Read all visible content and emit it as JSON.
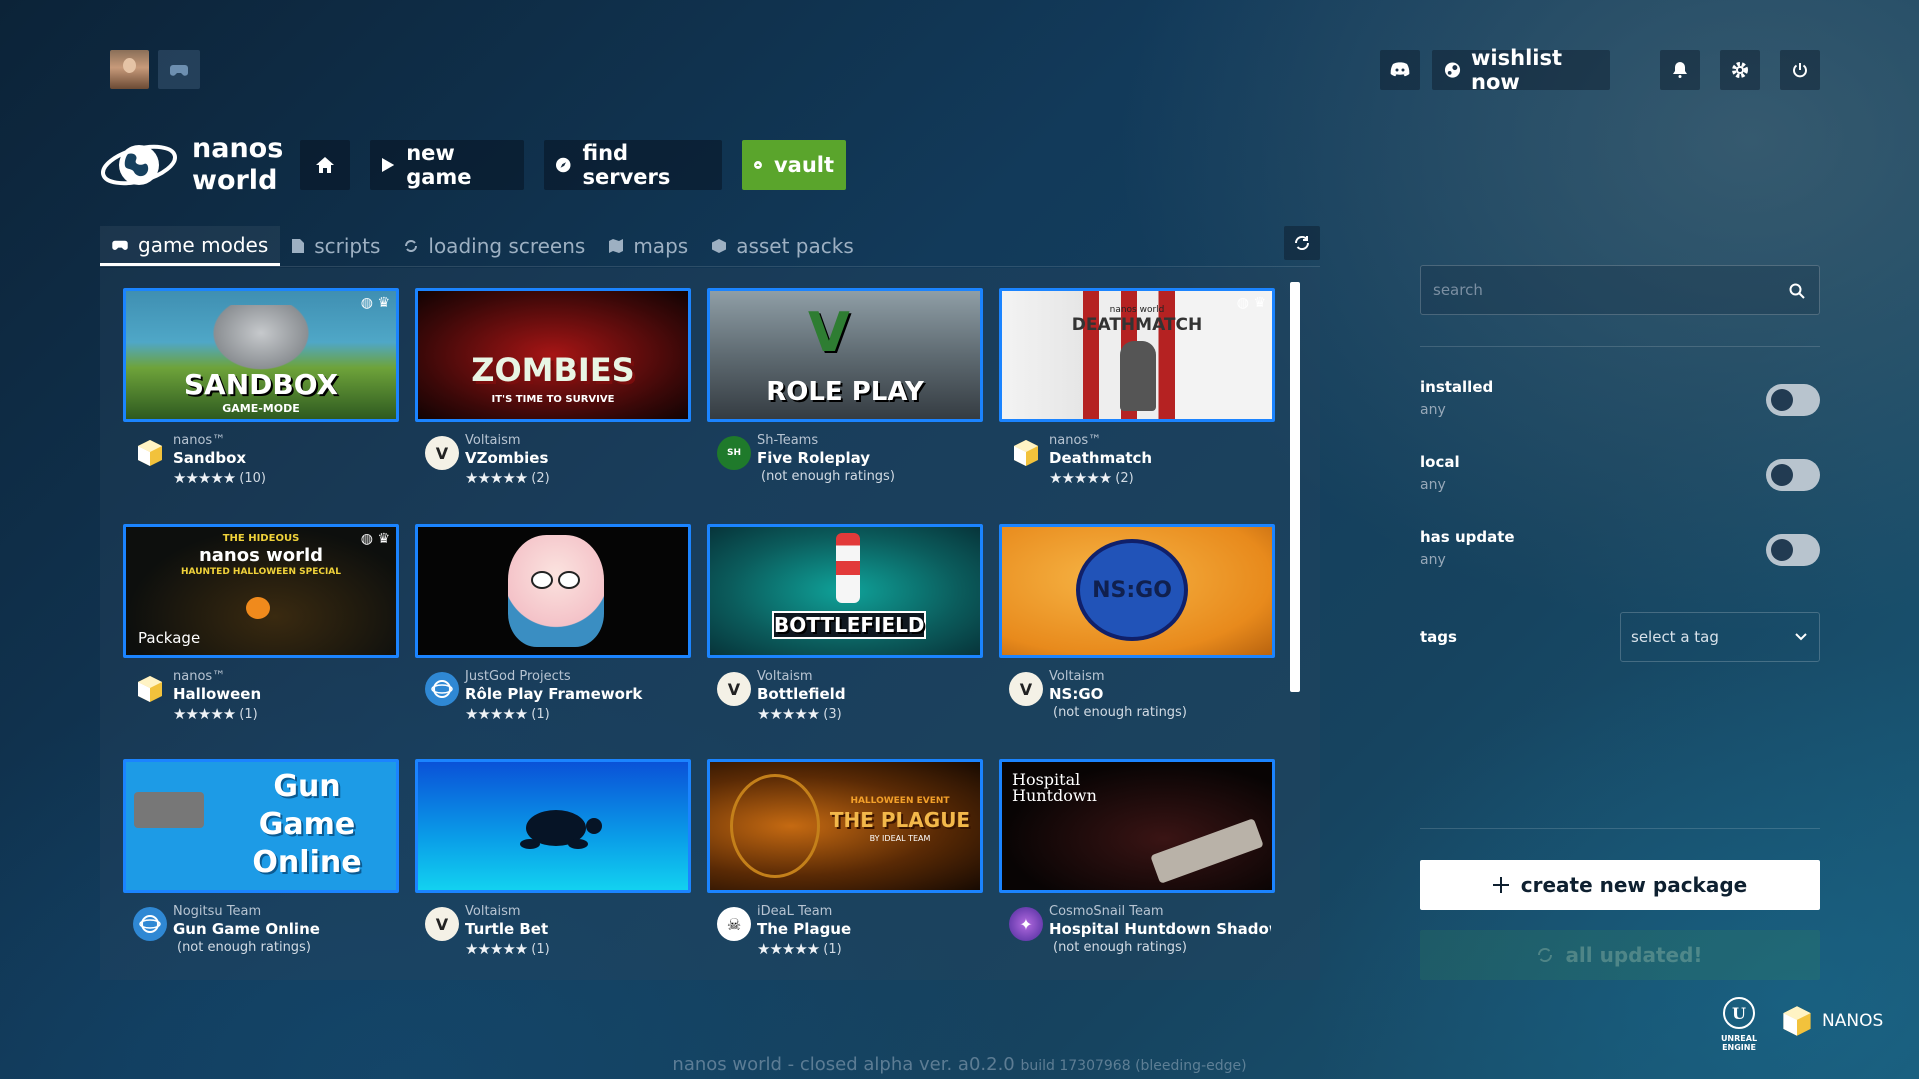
{
  "topbar": {
    "wishlist_label": "wishlist now"
  },
  "logo": {
    "line1": "nanos",
    "line2": "world"
  },
  "nav": {
    "new_game": "new game",
    "find_servers": "find servers",
    "vault": "vault"
  },
  "tabs": [
    {
      "label": "game modes",
      "active": true
    },
    {
      "label": "scripts"
    },
    {
      "label": "loading screens"
    },
    {
      "label": "maps"
    },
    {
      "label": "asset packs"
    }
  ],
  "packages": [
    {
      "author": "nanos™",
      "name": "Sandbox",
      "stars": "★★★★★",
      "count": "(10)",
      "thumb": "SANDBOX"
    },
    {
      "author": "Voltaism",
      "name": "VZombies",
      "stars": "★★★★★",
      "count": "(2)",
      "thumb": "ZOMBIES"
    },
    {
      "author": "Sh-Teams",
      "name": "Five Roleplay",
      "stars": "",
      "count": "(not enough ratings)",
      "thumb": "ROLE PLAY"
    },
    {
      "author": "nanos™",
      "name": "Deathmatch",
      "stars": "★★★★★",
      "count": "(2)",
      "thumb": "DEATHMATCH"
    },
    {
      "author": "nanos™",
      "name": "Halloween",
      "stars": "★★★★★",
      "count": "(1)",
      "thumb": "nanos world"
    },
    {
      "author": "JustGod Projects",
      "name": "Rôle Play Framework",
      "stars": "★★★★★",
      "count": "(1)",
      "thumb": ""
    },
    {
      "author": "Voltaism",
      "name": "Bottlefield",
      "stars": "★★★★★",
      "count": "(3)",
      "thumb": "BOTTLEFIELD"
    },
    {
      "author": "Voltaism",
      "name": "NS:GO",
      "stars": "",
      "count": "(not enough ratings)",
      "thumb": "NS:GO"
    },
    {
      "author": "Nogitsu Team",
      "name": "Gun Game Online",
      "stars": "",
      "count": "(not enough ratings)",
      "thumb": "Gun Game Online"
    },
    {
      "author": "Voltaism",
      "name": "Turtle Bet",
      "stars": "★★★★★",
      "count": "(1)",
      "thumb": ""
    },
    {
      "author": "iDeaL Team",
      "name": "The Plague",
      "stars": "★★★★★",
      "count": "(1)",
      "thumb": "THE PLAGUE"
    },
    {
      "author": "CosmoSnail Team",
      "name": "Hospital Huntdown Shadow:",
      "stars": "",
      "count": "(not enough ratings)",
      "thumb": "Hospital Huntdown"
    }
  ],
  "thumb_extra": {
    "sandbox_sub": "GAME-MODE",
    "zombies_sub": "IT'S TIME TO SURVIVE",
    "halloween_top": "THE HIDEOUS",
    "halloween_sub": "HAUNTED HALLOWEEN SPECIAL",
    "halloween_pkg": "Package",
    "plague_top": "HALLOWEEN EVENT",
    "plague_sub": "BY IDEAL TEAM",
    "deathmatch_top": "nanos world"
  },
  "sidebar": {
    "search_placeholder": "search",
    "filters": [
      {
        "label": "installed",
        "value": "any"
      },
      {
        "label": "local",
        "value": "any"
      },
      {
        "label": "has update",
        "value": "any"
      }
    ],
    "tags_label": "tags",
    "tags_select": "select a tag",
    "create_label": "create new package",
    "updated_label": "all updated!"
  },
  "brand": {
    "unreal": "UNREAL ENGINE",
    "nanos": "NANOS"
  },
  "footer": {
    "main": "nanos world - closed alpha  ver. a0.2.0",
    "build": "build 17307968  (bleeding-edge)"
  },
  "colors": {
    "accent": "#1b84ff",
    "vault": "#5aa52c"
  }
}
